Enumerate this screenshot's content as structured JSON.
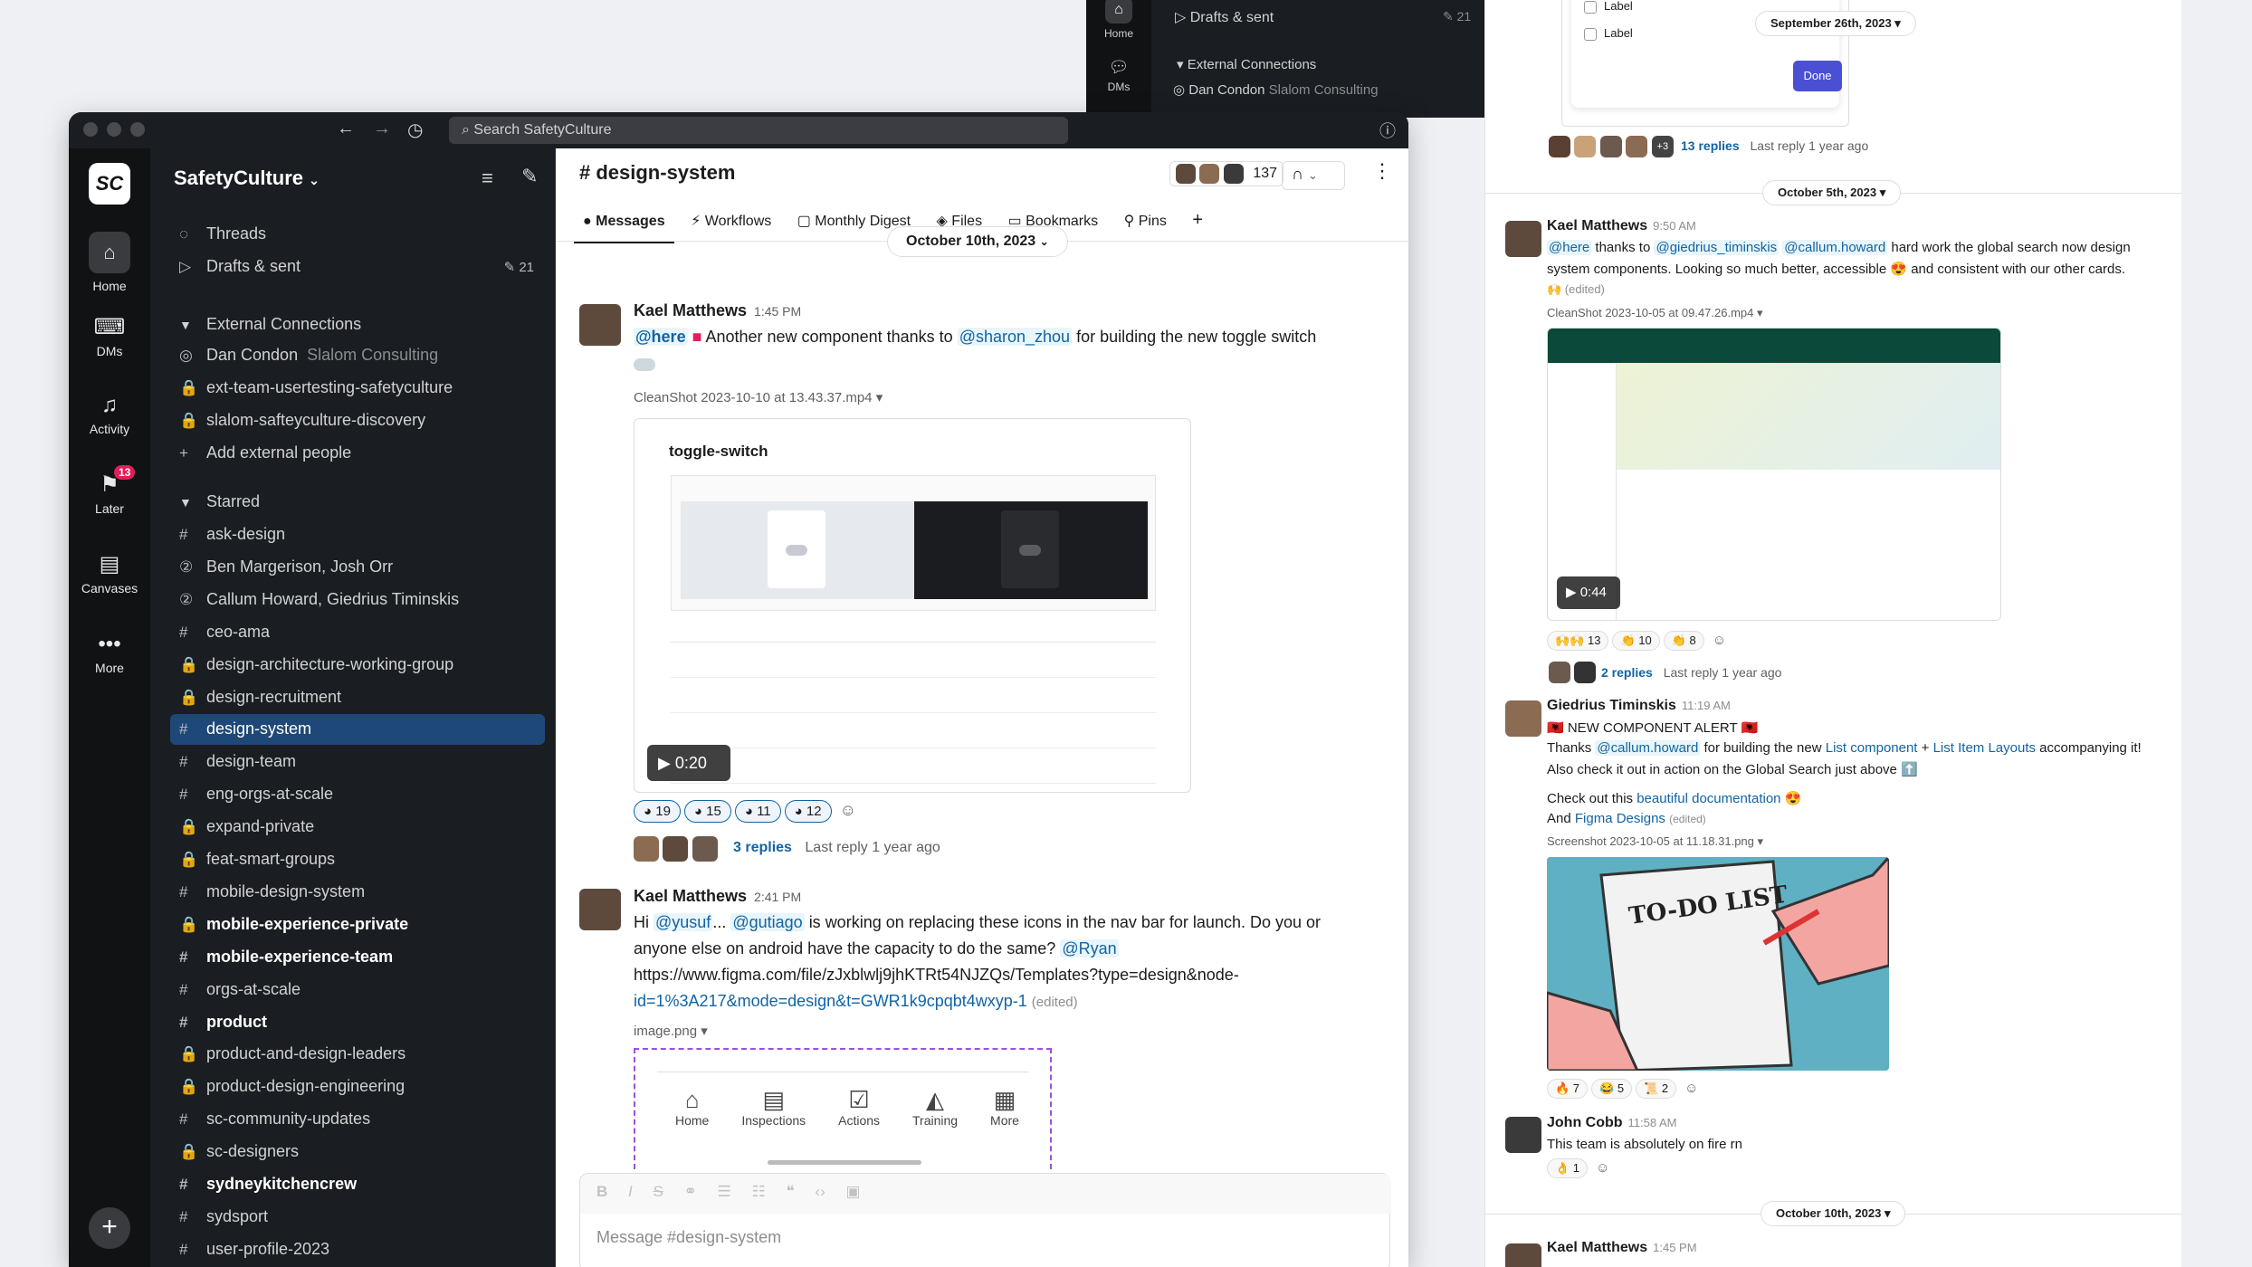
{
  "background_window": {
    "rail": [
      {
        "label": "Home"
      },
      {
        "label": "DMs"
      }
    ],
    "items": [
      "Drafts & sent",
      "External Connections"
    ],
    "drafts_count": "21",
    "person": "Dan Condon",
    "person_org": "Slalom Consulting"
  },
  "app": {
    "search_placeholder": "Search SafetyCulture",
    "workspace": "SafetyCulture",
    "rail": [
      {
        "label": "Home",
        "icon": "home-icon"
      },
      {
        "label": "DMs",
        "icon": "dms-icon"
      },
      {
        "label": "Activity",
        "icon": "bell-icon"
      },
      {
        "label": "Later",
        "icon": "bookmark-icon",
        "badge": "13"
      },
      {
        "label": "Canvases",
        "icon": "canvas-icon"
      },
      {
        "label": "More",
        "icon": "more-icon"
      }
    ]
  },
  "sidebar": {
    "top": [
      {
        "label": "Threads",
        "icon": "threads-icon"
      },
      {
        "label": "Drafts & sent",
        "icon": "send-icon",
        "count": "21"
      }
    ],
    "external_section": "External Connections",
    "external": [
      {
        "label": "Dan Condon",
        "sub": "Slalom Consulting",
        "pre": "◎"
      },
      {
        "label": "ext-team-usertesting-safetyculture",
        "pre": "🔒"
      },
      {
        "label": "slalom-safteyculture-discovery",
        "pre": "🔒"
      },
      {
        "label": "Add external people",
        "pre": "+"
      }
    ],
    "starred_section": "Starred",
    "channels": [
      {
        "label": "ask-design",
        "pre": "#"
      },
      {
        "label": "Ben Margerison, Josh Orr",
        "pre": "②"
      },
      {
        "label": "Callum Howard, Giedrius Timinskis",
        "pre": "②"
      },
      {
        "label": "ceo-ama",
        "pre": "#"
      },
      {
        "label": "design-architecture-working-group",
        "pre": "🔒"
      },
      {
        "label": "design-recruitment",
        "pre": "🔒"
      },
      {
        "label": "design-system",
        "pre": "#",
        "active": true
      },
      {
        "label": "design-team",
        "pre": "#"
      },
      {
        "label": "eng-orgs-at-scale",
        "pre": "#"
      },
      {
        "label": "expand-private",
        "pre": "🔒"
      },
      {
        "label": "feat-smart-groups",
        "pre": "🔒"
      },
      {
        "label": "mobile-design-system",
        "pre": "#"
      },
      {
        "label": "mobile-experience-private",
        "pre": "🔒",
        "bold": true
      },
      {
        "label": "mobile-experience-team",
        "pre": "#",
        "bold": true
      },
      {
        "label": "orgs-at-scale",
        "pre": "#"
      },
      {
        "label": "product",
        "pre": "#",
        "bold": true
      },
      {
        "label": "product-and-design-leaders",
        "pre": "🔒"
      },
      {
        "label": "product-design-engineering",
        "pre": "🔒"
      },
      {
        "label": "sc-community-updates",
        "pre": "#"
      },
      {
        "label": "sc-designers",
        "pre": "🔒"
      },
      {
        "label": "sydneykitchencrew",
        "pre": "#",
        "bold": true
      },
      {
        "label": "sydsport",
        "pre": "#"
      },
      {
        "label": "user-profile-2023",
        "pre": "#"
      }
    ]
  },
  "channel": {
    "name": "# design-system",
    "member_count": "137",
    "tabs": [
      "Messages",
      "Workflows",
      "Monthly Digest",
      "Files",
      "Bookmarks",
      "Pins",
      "+"
    ],
    "date": "October 10th, 2023",
    "messages": [
      {
        "author": "Kael Matthews",
        "time": "1:45 PM",
        "here": "@here",
        "text_a": "Another new component thanks to",
        "mention": "@sharon_zhou",
        "text_b": "for building the new toggle switch",
        "attachment": "CleanShot 2023-10-10 at 13.43.37.mp4 ▾",
        "video_title": "toggle-switch",
        "duration": "0:20",
        "reactions": [
          "19",
          "15",
          "11",
          "12"
        ],
        "replies": "3 replies",
        "last_reply": "Last reply 1 year ago"
      },
      {
        "author": "Kael Matthews",
        "time": "2:41 PM",
        "hi": "Hi",
        "mention_a": "@yusuf",
        "dots": "...",
        "mention_b": "@gutiago",
        "text_a": "is working on replacing these icons in the nav bar for launch. Do you or",
        "text_b": "anyone else on android have the capacity to do the same?",
        "mention_c": "@Ryan",
        "link_a": "https://www.figma.com/file/zJxblwlj9jhKTRt54NJZQs/Templates?type=design&node-",
        "link_b": "id=1%3A217&mode=design&t=GWR1k9cpqbt4wxyp-1",
        "edited": "(edited)",
        "attachment": "image.png ▾",
        "nav": [
          "Home",
          "Inspections",
          "Actions",
          "Training",
          "More"
        ]
      }
    ],
    "composer_placeholder": "Message #design-system"
  },
  "thread": {
    "checkbox_labels": [
      "Label",
      "Label"
    ],
    "done": "Done",
    "date_1": "September 26th, 2023 ▾",
    "replies_1": "13 replies",
    "last_reply_1": "Last reply 1 year ago",
    "date_2": "October 5th, 2023 ▾",
    "msg_a": {
      "author": "Kael Matthews",
      "time": "9:50 AM",
      "line1_a": "thanks to",
      "m1": "@here",
      "m2": "@giedrius_timinskis",
      "m3": "@callum.howard",
      "line1_b": "hard work the global search now design",
      "line2": "system components. Looking so much better, accessible 😍 and consistent with our other cards.",
      "edited": "🙌 (edited)",
      "attachment": "CleanShot 2023-10-05 at 09.47.26.mp4 ▾",
      "duration": "0:44",
      "reactions": [
        "🙌🙌 13",
        "👏 10",
        "👏 8"
      ],
      "replies": "2 replies",
      "last_reply": "Last reply 1 year ago"
    },
    "msg_b": {
      "author": "Giedrius Timinskis",
      "time": "11:19 AM",
      "title": "🇦🇱 NEW COMPONENT ALERT 🇦🇱",
      "line1_a": "Thanks",
      "m1": "@callum.howard",
      "line1_b": "for building the new",
      "link1": "List component",
      "plus": "+",
      "link2": "List Item Layouts",
      "line1_c": "accompanying it!",
      "line2": "Also check it out in action on the Global Search just above ⬆️",
      "line3_a": "Check out this",
      "link3": "beautiful documentation",
      "line3_b": "😍",
      "line4_a": "And",
      "link4": "Figma Designs",
      "edited": "(edited)",
      "attachment": "Screenshot 2023-10-05 at 11.18.31.png ▾",
      "meme_text": "TO-DO LIST",
      "reactions": [
        "🔥 7",
        "😂 5",
        "📜 2"
      ]
    },
    "msg_c": {
      "author": "John Cobb",
      "time": "11:58 AM",
      "text": "This team is absolutely on fire rn",
      "reactions": [
        "👌 1"
      ]
    },
    "date_3": "October 10th, 2023 ▾",
    "msg_d": {
      "author": "Kael Matthews",
      "time": "1:45 PM"
    }
  },
  "colors": {
    "accent": "#1d4877",
    "mention": "#1264a3",
    "badge": "#e01e5a",
    "done_button": "#4a4fd4"
  }
}
